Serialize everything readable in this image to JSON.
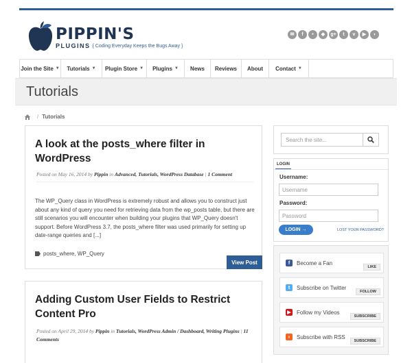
{
  "logo": {
    "name": "PIPPIN'S",
    "plugins": "PLUGINS",
    "tagline": "{ Coding Everyday Keeps the Bugs Away }"
  },
  "social_icons": [
    {
      "name": "email-icon",
      "glyph": "✉",
      "color": "#9a9a9a"
    },
    {
      "name": "facebook-icon",
      "glyph": "f",
      "color": "#9a9a9a"
    },
    {
      "name": "flickr-icon",
      "glyph": "•",
      "color": "#9a9a9a"
    },
    {
      "name": "github-icon",
      "glyph": "◆",
      "color": "#9a9a9a"
    },
    {
      "name": "google-plus-icon",
      "glyph": "g+",
      "color": "#9a9a9a"
    },
    {
      "name": "twitter-icon",
      "glyph": "t",
      "color": "#9a9a9a"
    },
    {
      "name": "vimeo-icon",
      "glyph": "v",
      "color": "#9a9a9a"
    },
    {
      "name": "youtube-icon",
      "glyph": "▶",
      "color": "#9a9a9a"
    },
    {
      "name": "rss-icon",
      "glyph": "◗",
      "color": "#9a9a9a"
    }
  ],
  "nav": {
    "items": [
      {
        "label": "Join the Site",
        "dropdown": true
      },
      {
        "label": "Tutorials",
        "dropdown": true
      },
      {
        "label": "Plugin Store",
        "dropdown": true
      },
      {
        "label": "Plugins",
        "dropdown": true
      },
      {
        "label": "News",
        "dropdown": false
      },
      {
        "label": "Reviews",
        "dropdown": false
      },
      {
        "label": "About",
        "dropdown": false
      },
      {
        "label": "Contact",
        "dropdown": true
      }
    ]
  },
  "page": {
    "title": "Tutorials"
  },
  "breadcrumb": {
    "separator": "/",
    "current": "Tutorials"
  },
  "posts": [
    {
      "title": "A look at the posts_where filter in WordPress",
      "meta_prefix": "Posted on May 16, 2014 by",
      "author": "Pippin",
      "in": "in",
      "categories": "Advanced, Tutorials, WordPress Database",
      "comments": "1 Comment",
      "excerpt": "The WP_Query class in WordPress is extremely robust and allows you to construct just about any kind of query you need for retrieving data from the wp_posts table, but there are still scenarios you will encounter when building your plugins that WP_Query doesn't support. Before WordPress 3.7, the posts_where filter was used primarily for setting up date-range queries and [...]",
      "tags": "posts_where, WP_Query",
      "button": "View Post"
    },
    {
      "title": "Adding Custom User Fields to Restrict Content Pro",
      "meta_prefix": "Posted on April 29, 2014 by",
      "author": "Pippin",
      "in": "in",
      "categories": "Tutorials, WordPress Admin / Dashboard, Writing Plugins",
      "comments": "11 Comments"
    }
  ],
  "sidebar": {
    "search": {
      "placeholder": "Search the site..."
    },
    "login": {
      "tab": "LOGIN",
      "username_label": "Username:",
      "username_placeholder": "Username",
      "password_label": "Password:",
      "password_placeholder": "Password",
      "button": "LOGIN →",
      "lost_password": "LOST YOUR PASSWORD?"
    },
    "social": [
      {
        "icon": "facebook-icon",
        "glyph": "f",
        "color": "#3b5998",
        "text": "Become a Fan",
        "button": "LIKE"
      },
      {
        "icon": "twitter-icon",
        "glyph": "t",
        "color": "#55acee",
        "text": "Subscribe on Twitter",
        "button": "FOLLOW"
      },
      {
        "icon": "youtube-icon",
        "glyph": "▶",
        "color": "#cc181e",
        "text": "Follow my Videos",
        "button": "SUBSCRIBE"
      },
      {
        "icon": "rss-icon",
        "glyph": "◗",
        "color": "#f26522",
        "text": "Subscribe with RSS",
        "button": "SUBSCRIBE"
      }
    ]
  }
}
